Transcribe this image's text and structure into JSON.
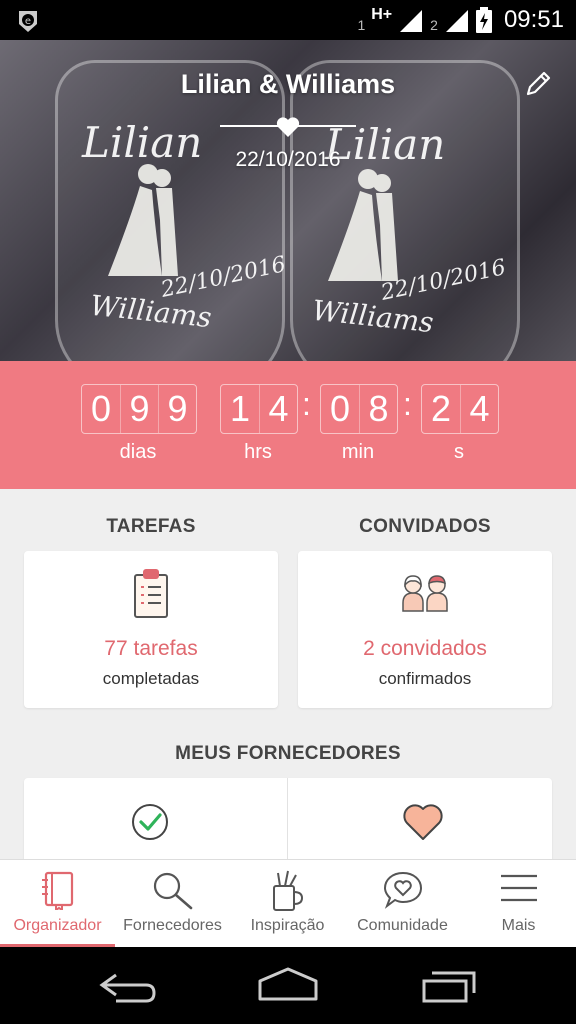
{
  "status_bar": {
    "sim1": "1",
    "network": "H+",
    "sim2": "2",
    "time": "09:51"
  },
  "hero": {
    "couple_names": "Lilian & Williams",
    "wedding_date": "22/10/2016",
    "glass_text": {
      "name_left": "Lilian",
      "name_right": "Lilian",
      "date_left": "22/10/2016",
      "date_right": "22/10/2016",
      "groom_left": "Williams",
      "groom_right": "Williams"
    }
  },
  "countdown": {
    "days": [
      "0",
      "9",
      "9"
    ],
    "hours": [
      "1",
      "4"
    ],
    "minutes": [
      "0",
      "8"
    ],
    "seconds": [
      "2",
      "4"
    ],
    "separator": ":",
    "labels": {
      "days": "dias",
      "hours": "hrs",
      "minutes": "min",
      "seconds": "s"
    }
  },
  "sections": {
    "tasks": {
      "heading": "TAREFAS",
      "value": "77 tarefas",
      "subtitle": "completadas"
    },
    "guests": {
      "heading": "CONVIDADOS",
      "value": "2 convidados",
      "subtitle": "confirmados"
    },
    "vendors": {
      "heading": "MEUS FORNECEDORES"
    }
  },
  "bottom_nav": [
    {
      "label": "Organizador",
      "icon": "notebook-icon",
      "active": true
    },
    {
      "label": "Fornecedores",
      "icon": "search-icon",
      "active": false
    },
    {
      "label": "Inspiração",
      "icon": "brush-cup-icon",
      "active": false
    },
    {
      "label": "Comunidade",
      "icon": "chat-heart-icon",
      "active": false
    },
    {
      "label": "Mais",
      "icon": "menu-icon",
      "active": false
    }
  ],
  "colors": {
    "accent": "#f07a82",
    "accent_text": "#e0686f",
    "background": "#efefef"
  }
}
